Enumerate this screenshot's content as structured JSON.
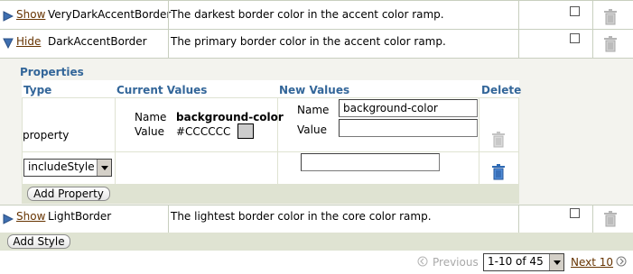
{
  "rows": [
    {
      "toggle": "Show",
      "name": "VeryDarkAccentBorder",
      "description": "The darkest border color in the accent color ramp."
    },
    {
      "toggle": "Hide",
      "name": "DarkAccentBorder",
      "description": "The primary border color in the accent color ramp."
    },
    {
      "toggle": "Show",
      "name": "LightBorder",
      "description": "The lightest border color in the core color ramp."
    }
  ],
  "properties": {
    "title": "Properties",
    "headers": {
      "type": "Type",
      "current": "Current Values",
      "new": "New Values",
      "delete": "Delete"
    },
    "property_row": {
      "type": "property",
      "name_label": "Name",
      "name_value": "background-color",
      "value_label": "Value",
      "value_value": "#CCCCCC",
      "swatch_color": "#cccccc",
      "new_name_label": "Name",
      "new_name_value": "background-color",
      "new_value_label": "Value",
      "new_value_value": ""
    },
    "include_style_select": "includeStyle",
    "include_style_input": "",
    "add_property_label": "Add Property"
  },
  "add_style_label": "Add Style",
  "pagination": {
    "previous_label": "Previous",
    "range_value": "1-10 of 45",
    "next_label": "Next 10"
  },
  "colors": {
    "accent_band": "#dfe3d2",
    "property_panel": "#f3f3ee",
    "header_text": "#336699",
    "link": "#663300",
    "trash_active": "#2e6ab4"
  }
}
